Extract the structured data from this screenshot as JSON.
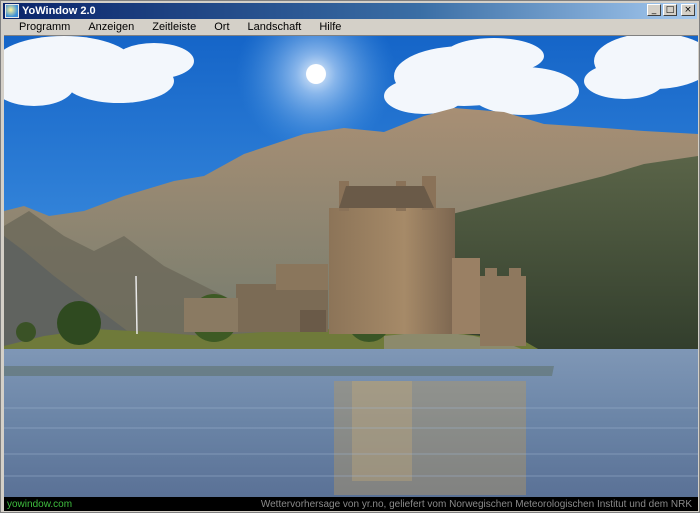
{
  "window": {
    "title": "YoWindow 2.0",
    "buttons": {
      "minimize": "_",
      "maximize": "□",
      "close": "×"
    }
  },
  "menu": {
    "items": [
      "Programm",
      "Anzeigen",
      "Zeitleiste",
      "Ort",
      "Landschaft",
      "Hilfe"
    ]
  },
  "status": {
    "site": "yowindow.com",
    "credit": "Wettervorhersage von yr.no, geliefert vom Norwegischen Meteorologischen Institut und dem NRK"
  },
  "colors": {
    "titlebar_start": "#0a246a",
    "sky": "#1f6fd6",
    "water": "#6a89b0",
    "status_site": "#3fbf3f",
    "status_credit": "#8a8a8a"
  },
  "icons": [
    "app-icon",
    "minimize-icon",
    "maximize-icon",
    "close-icon"
  ]
}
